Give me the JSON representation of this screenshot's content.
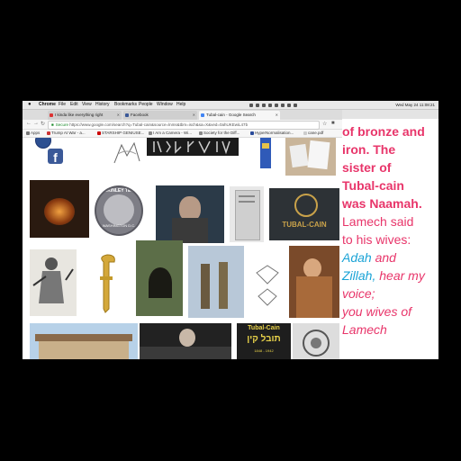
{
  "menubar": {
    "apple": "",
    "items": [
      "Chrome",
      "File",
      "Edit",
      "View",
      "History",
      "Bookmarks",
      "People",
      "Window",
      "Help"
    ],
    "clock": "Wed May 24  11:08:21"
  },
  "tabs": [
    {
      "label": "I kinda like everything right",
      "icon_color": "#d33"
    },
    {
      "label": "Facebook",
      "icon_color": "#3b5998"
    },
    {
      "label": "Tubal-cain - Google Search",
      "icon_color": "#4285f4"
    }
  ],
  "address": {
    "secure_label": "Secure",
    "url": "https://www.google.com/search?q=Tubal-cain&source=lnms&tbm=isch&sa=X&ved=0ahUKEwiL47b"
  },
  "bookmarks": [
    {
      "label": "Apps",
      "color": "#777"
    },
    {
      "label": "Trump At War - a...",
      "color": "#c33"
    },
    {
      "label": "STARSHIP GENIUSE...",
      "color": "#c00"
    },
    {
      "label": "I Am a Camera - Wi...",
      "color": "#888"
    },
    {
      "label": "Society for the Diff...",
      "color": "#888"
    },
    {
      "label": "HyperNormalisation...",
      "color": "#2a4a9a"
    },
    {
      "label": "cane.pdf",
      "color": "#ccc"
    }
  ],
  "thumbnails": {
    "mckinley": [
      "M",
      "C",
      "K",
      "I",
      "N",
      "L",
      "E",
      "Y",
      " ",
      "T",
      "E",
      "C",
      "H"
    ],
    "washington": "WASHINGTON D.C.",
    "tubal_logo": "TUBAL-CAIN",
    "tubal_hebrew_title": "Tubal-Cain",
    "tubal_hebrew": "תובל קין",
    "tubal_dates": "1848 - 1942"
  },
  "side_panel": {
    "lines": [
      {
        "text": "of bronze and",
        "style": "bold"
      },
      {
        "text": "iron. The",
        "style": "bold"
      },
      {
        "text": "sister of",
        "style": "bold"
      },
      {
        "text": "Tubal-cain",
        "style": "bold"
      },
      {
        "text": "was Naamah.",
        "style": "bold"
      },
      {
        "text": "Lamech said",
        "style": "pink"
      },
      {
        "text": "to his wives:",
        "style": "pink"
      },
      {
        "text": "Adah and",
        "style": "mixed1"
      },
      {
        "text": "Zillah, hear my",
        "style": "mixed2"
      },
      {
        "text": "voice;",
        "style": "pinki"
      },
      {
        "text": "you wives of",
        "style": "pinki"
      },
      {
        "text": "Lamech",
        "style": "pinki"
      }
    ],
    "mixed": {
      "adah": "Adah",
      "and": " and",
      "zillah": "Zillah,",
      "hear": " hear my"
    }
  }
}
